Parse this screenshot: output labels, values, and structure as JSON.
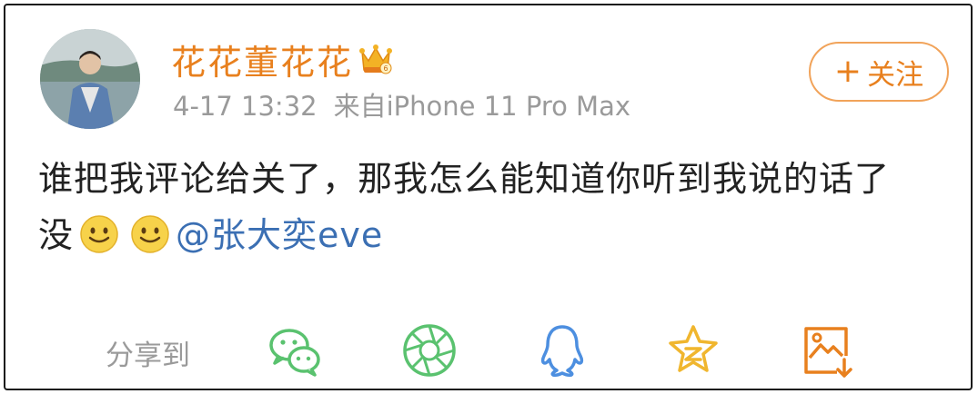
{
  "post": {
    "username": "花花董花花",
    "time": "4-17 13:32",
    "source": "来自iPhone 11 Pro Max",
    "follow_label": "关注",
    "text_line1": "谁把我评论给关了，那我怎么能知道你听到我说的话了",
    "text_line2_prefix": "没",
    "mention": "@张大奕eve"
  },
  "share": {
    "label": "分享到",
    "targets": [
      "wechat-icon",
      "moments-icon",
      "qq-icon",
      "qzone-icon",
      "save-image-icon"
    ]
  },
  "colors": {
    "username": "#e8801e",
    "mention": "#3b6fb3",
    "meta": "#9a9a9a",
    "icon_green": "#5ac26f",
    "icon_blue": "#4d8fe0",
    "icon_yellow": "#f0b62e",
    "icon_orange": "#e8801e"
  }
}
